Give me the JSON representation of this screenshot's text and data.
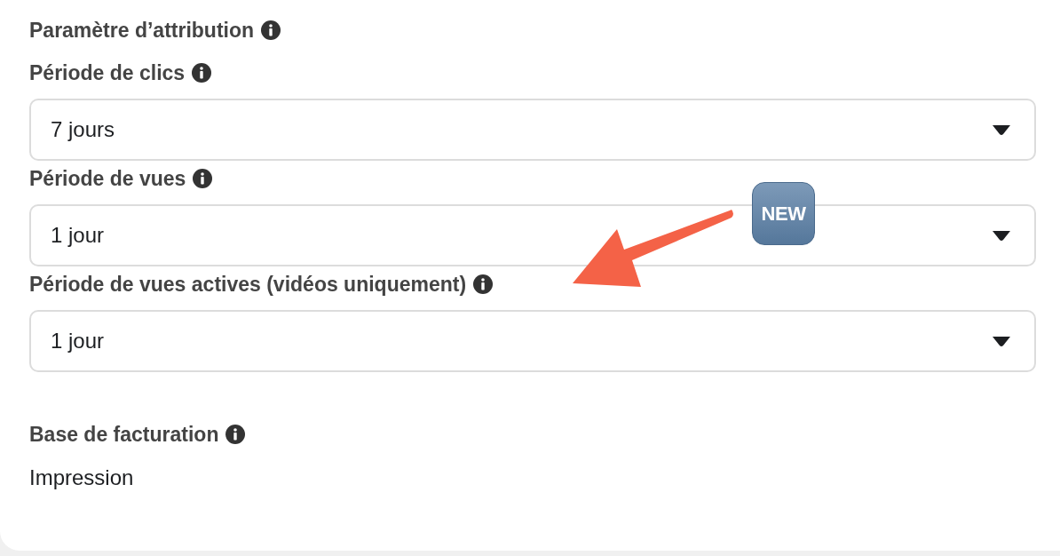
{
  "section": {
    "title": "Paramètre d’attribution"
  },
  "fields": [
    {
      "label": "Période de clics",
      "value": "7 jours"
    },
    {
      "label": "Période de vues",
      "value": "1 jour"
    },
    {
      "label": "Période de vues actives (vidéos uniquement)",
      "value": "1 jour"
    }
  ],
  "billing": {
    "label": "Base de facturation",
    "value": "Impression"
  },
  "annotation": {
    "badge": "NEW"
  }
}
